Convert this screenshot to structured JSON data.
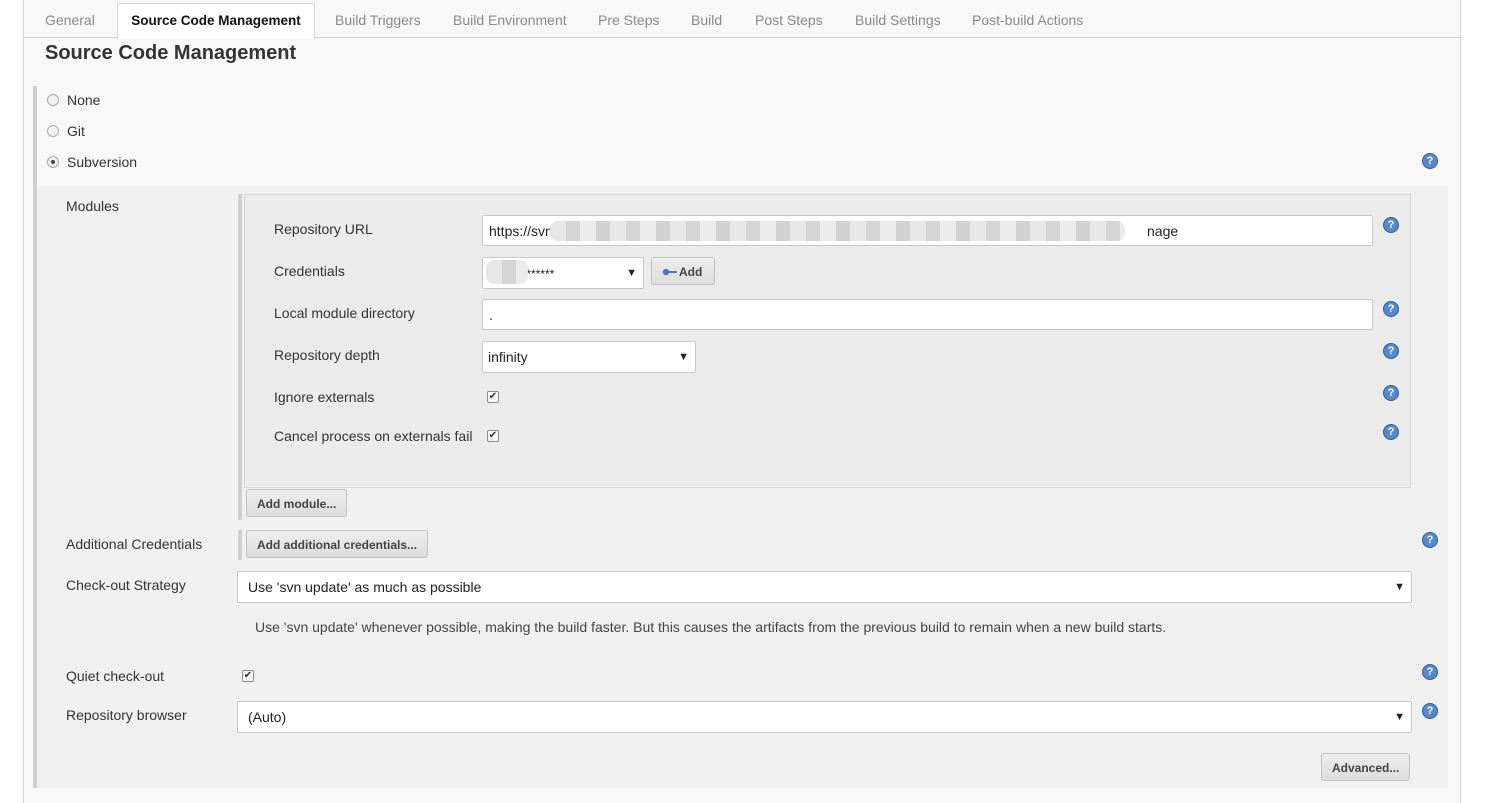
{
  "tabs": [
    {
      "label": "General"
    },
    {
      "label": "Source Code Management"
    },
    {
      "label": "Build Triggers"
    },
    {
      "label": "Build Environment"
    },
    {
      "label": "Pre Steps"
    },
    {
      "label": "Build"
    },
    {
      "label": "Post Steps"
    },
    {
      "label": "Build Settings"
    },
    {
      "label": "Post-build Actions"
    }
  ],
  "section_title": "Source Code Management",
  "scm_options": [
    {
      "label": "None",
      "checked": false
    },
    {
      "label": "Git",
      "checked": false
    },
    {
      "label": "Subversion",
      "checked": true
    }
  ],
  "modules": {
    "label": "Modules",
    "repository_url_label": "Repository URL",
    "repository_url_prefix": "https://svn",
    "repository_url_suffix": "nage",
    "credentials_label": "Credentials",
    "credentials_value": "/******",
    "add_button": "Add",
    "local_dir_label": "Local module directory",
    "local_dir_value": ".",
    "depth_label": "Repository depth",
    "depth_value": "infinity",
    "ignore_externals_label": "Ignore externals",
    "ignore_externals_checked": true,
    "cancel_externals_label": "Cancel process on externals fail",
    "cancel_externals_checked": true,
    "add_module_button": "Add module..."
  },
  "additional_credentials": {
    "label": "Additional Credentials",
    "button": "Add additional credentials..."
  },
  "checkout": {
    "label": "Check-out Strategy",
    "value": "Use 'svn update' as much as possible",
    "description": "Use 'svn update' whenever possible, making the build faster. But this causes the artifacts from the previous build to remain when a new build starts."
  },
  "quiet": {
    "label": "Quiet check-out",
    "checked": true
  },
  "browser": {
    "label": "Repository browser",
    "value": "(Auto)"
  },
  "advanced_button": "Advanced...",
  "help_glyph": "?",
  "caret_glyph": "▼",
  "check_glyph": "✔",
  "colors": {
    "help": "#5a87c5",
    "panel": "#f8f8f8",
    "border": "#d3d3d3"
  }
}
